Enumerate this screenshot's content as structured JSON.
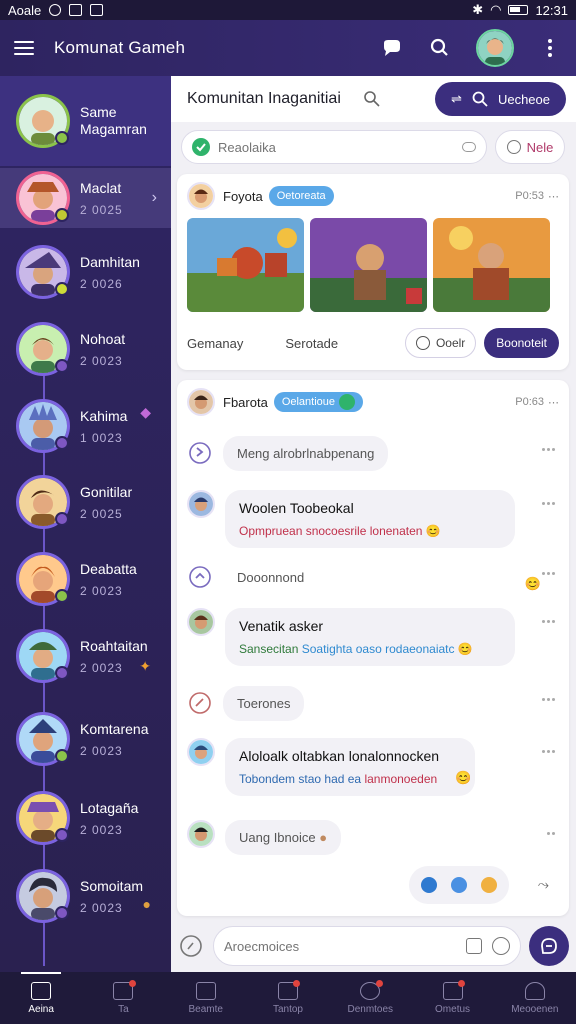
{
  "status_bar": {
    "carrier": "Aoale",
    "time": "12:31"
  },
  "app_bar": {
    "title": "Komunat Gameh",
    "icons": [
      "menu-icon",
      "chat-bubble-icon",
      "search-icon",
      "profile-avatar",
      "more-vert-icon"
    ]
  },
  "sidebar": {
    "items": [
      {
        "name": "Same",
        "name2": "Magamran",
        "meta": ""
      },
      {
        "name": "Maclat",
        "meta": "2 0025"
      },
      {
        "name": "Damhitan",
        "meta": "2 0026"
      },
      {
        "name": "Nohoat",
        "meta": "2 0023"
      },
      {
        "name": "Kahima",
        "meta": "1 0023"
      },
      {
        "name": "Gonitilar",
        "meta": "2 0025"
      },
      {
        "name": "Deabatta",
        "meta": "2 0023"
      },
      {
        "name": "Roahtaitan",
        "meta": "2 0023"
      },
      {
        "name": "Komtarena",
        "meta": "2 0023"
      },
      {
        "name": "Lotagaña",
        "meta": "2 0023"
      },
      {
        "name": "Somoitam",
        "meta": "2 0023"
      }
    ]
  },
  "main": {
    "title": "Komunitan Inaganitiai",
    "header_button": "Uecheoe",
    "search_placeholder": "Reaolaika",
    "new_label": "Nele",
    "post1": {
      "author": "Foyota",
      "tag": "Oetoreata",
      "time": "P0:53",
      "action1": "Gemanay",
      "action2": "Serotade",
      "ghost_btn": "Ooelr",
      "solid_btn": "Boonoteit"
    },
    "post2": {
      "author": "Fbarota",
      "tag": "Oelantioue",
      "time": "P0:63",
      "messages": [
        {
          "text": "Meng alrobrlnabpenang"
        },
        {
          "title": "Woolen Toobeokal",
          "sub": "Opmpruean snocoesrile lonenaten"
        },
        {
          "text": "Dooonnond"
        },
        {
          "title": "Venatik asker",
          "sub": "Sansecitan",
          "sub2": "Soatighta oaso rodaeonaiatc"
        },
        {
          "text": "Toerones"
        },
        {
          "title": "Aloloalk oltabkan lonalonnocken",
          "sub": "Tobondem stao had ea",
          "sub2": "lanmonoeden"
        },
        {
          "text": "Uang Ibnoice"
        }
      ]
    },
    "composer_placeholder": "Aroecmoices"
  },
  "bottom_nav": [
    {
      "label": "Aeina",
      "active": true
    },
    {
      "label": "Ta",
      "badge": true
    },
    {
      "label": "Beamte"
    },
    {
      "label": "Tantop",
      "badge": true
    },
    {
      "label": "Denmtoes",
      "badge": true
    },
    {
      "label": "Ometus",
      "badge": true
    },
    {
      "label": "Meooenen"
    }
  ],
  "colors": {
    "primary": "#3b2e7e",
    "sidebar": "#2f2563",
    "accent_blue": "#5aa8e8",
    "success": "#2fb36b"
  }
}
